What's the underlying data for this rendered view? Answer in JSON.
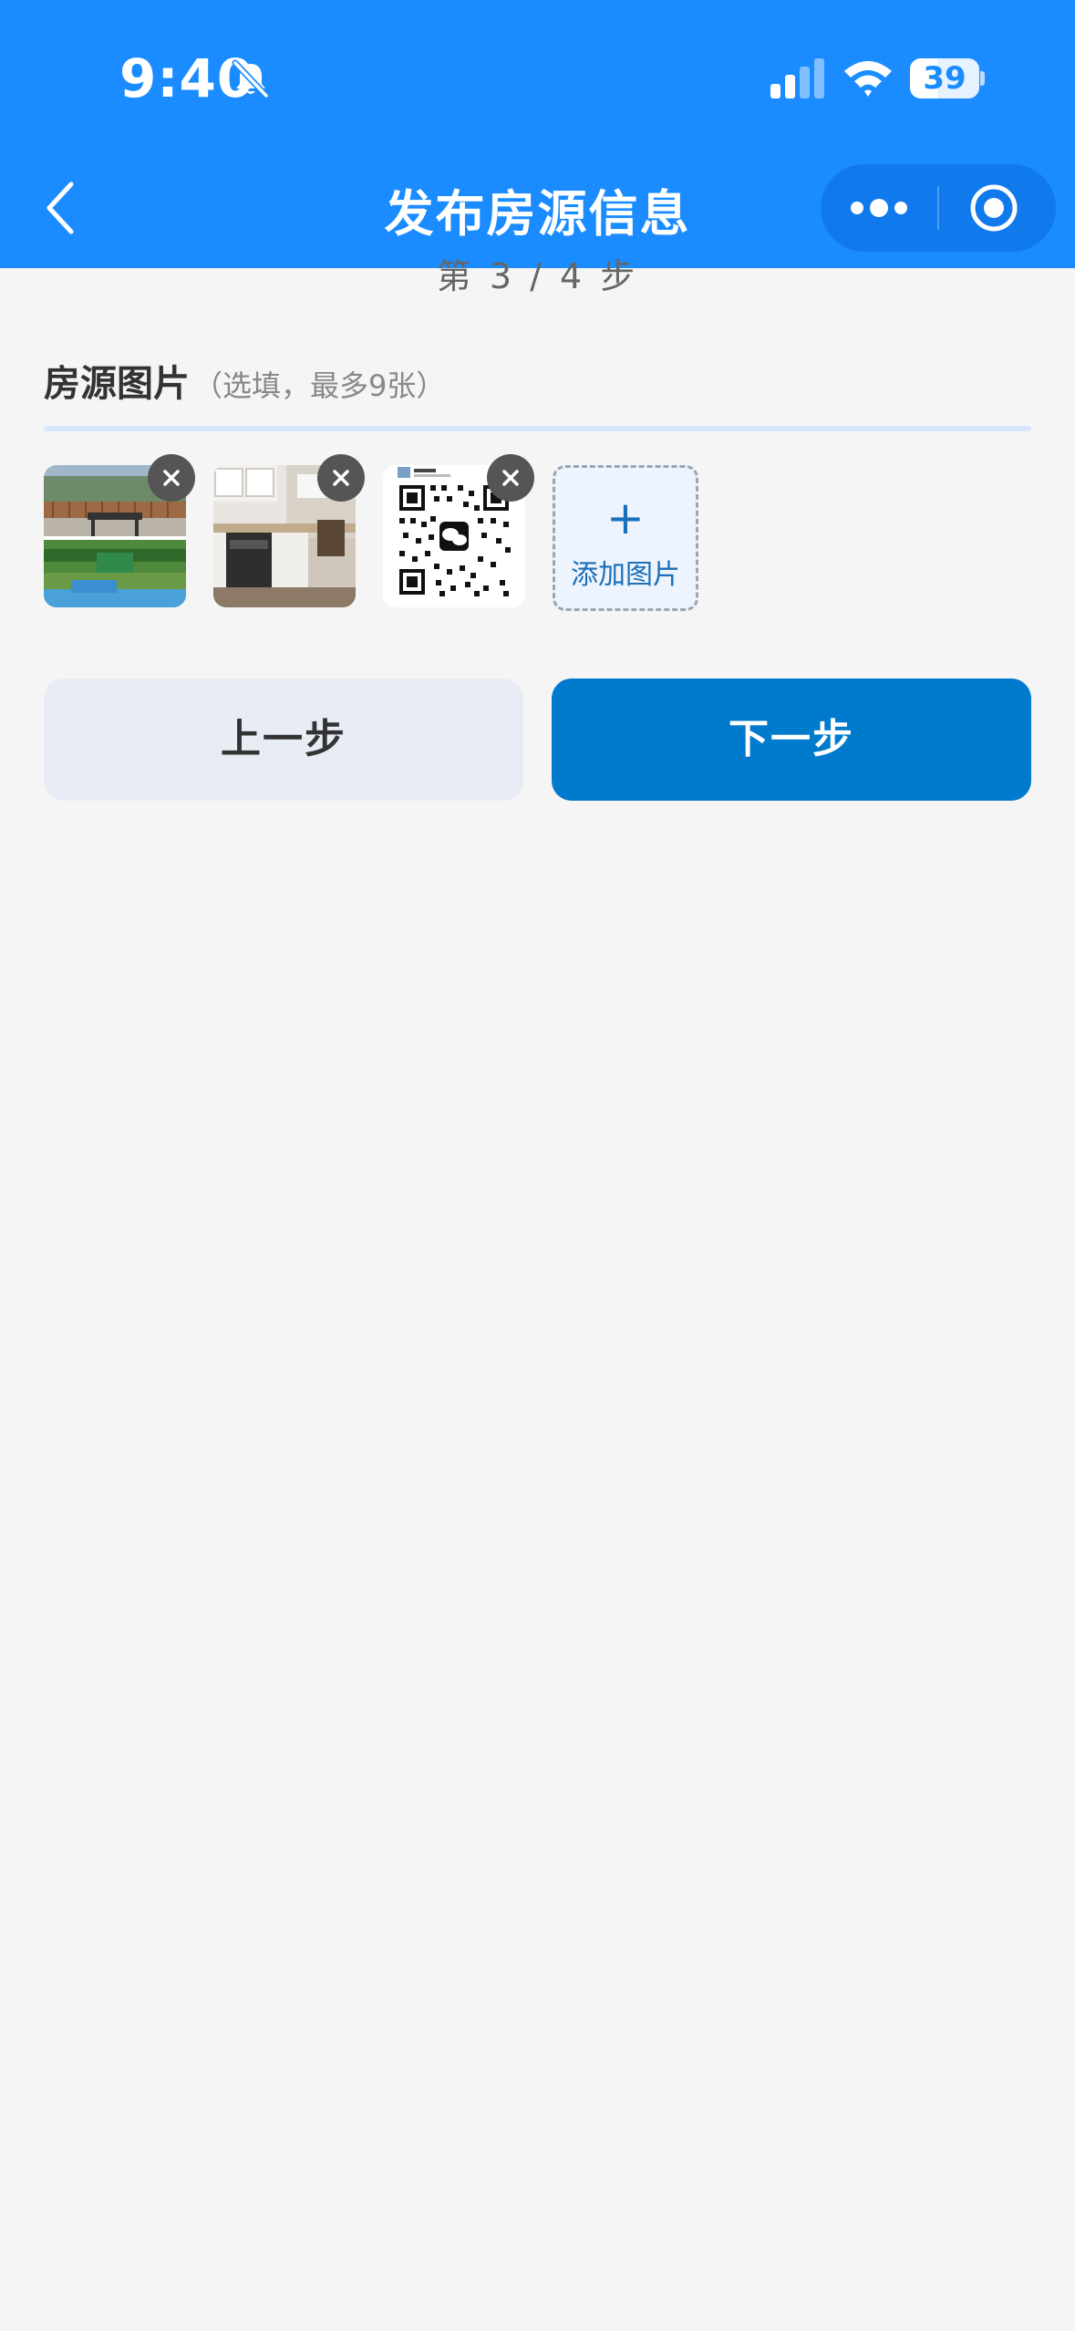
{
  "status_bar": {
    "time": "9:40",
    "battery_level": "39",
    "battery_fraction": 0.39
  },
  "nav": {
    "title": "发布房源信息",
    "back_icon": "chevron-left-icon",
    "more_icon": "more-dots-icon",
    "close_icon": "target-circle-icon"
  },
  "step": {
    "text": "第 3 / 4 步"
  },
  "photos_section": {
    "title": "房源图片",
    "hint": "（选填，最多9张）",
    "photos": [
      {
        "name": "patio-garden-photo"
      },
      {
        "name": "kitchen-photo"
      },
      {
        "name": "wechat-qr-code-photo"
      }
    ],
    "remove_icon": "close-icon",
    "add_button": {
      "icon": "+",
      "label": "添加图片"
    }
  },
  "buttons": {
    "prev_label": "上一步",
    "next_label": "下一步"
  },
  "colors": {
    "header_bg": "#1a8cff",
    "primary_button": "#007acc",
    "secondary_button": "#e8edf5",
    "page_bg": "#f5f5f5"
  }
}
